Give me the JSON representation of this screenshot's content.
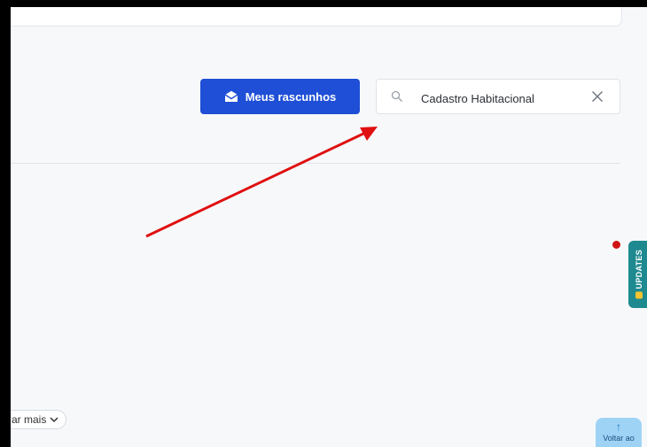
{
  "toolbar": {
    "drafts_label": "Meus rascunhos",
    "drafts_icon": "envelope-open-icon",
    "accent_color": "#1f4fd6"
  },
  "search": {
    "value": "Cadastro Habitacional",
    "search_icon": "search-icon",
    "clear_icon": "close-icon"
  },
  "updates_tab": {
    "label": "UPDATES",
    "color": "#1e8a90",
    "notification_color": "#d01414"
  },
  "footer": {
    "show_more_label": "ar mais",
    "back_to_top_label": "Voltar ao"
  },
  "annotation": {
    "arrow_color": "#e01010"
  }
}
